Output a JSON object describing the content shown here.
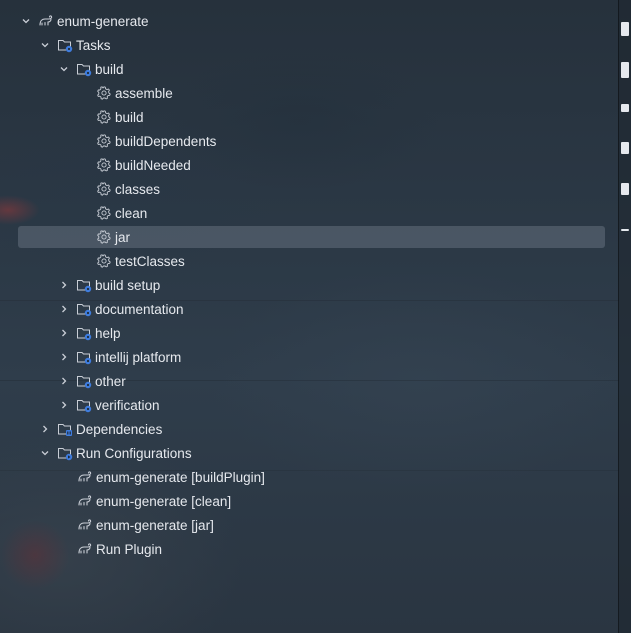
{
  "tree": {
    "root": {
      "label": "enum-generate",
      "icon": "gradle-elephant-icon"
    },
    "tasks": {
      "label": "Tasks",
      "icon": "folder-gear-icon"
    },
    "build_group": {
      "label": "build",
      "icon": "folder-gear-icon"
    },
    "build_tasks": [
      "assemble",
      "build",
      "buildDependents",
      "buildNeeded",
      "classes",
      "clean",
      "jar",
      "testClasses"
    ],
    "task_groups": [
      "build setup",
      "documentation",
      "help",
      "intellij platform",
      "other",
      "verification"
    ],
    "dependencies": {
      "label": "Dependencies",
      "icon": "folder-library-icon"
    },
    "run_configurations": {
      "label": "Run Configurations",
      "icon": "folder-run-icon",
      "items": [
        "enum-generate [buildPlugin]",
        "enum-generate [clean]",
        "enum-generate [jar]",
        "Run Plugin"
      ]
    },
    "selected_task": "jar"
  },
  "colors": {
    "text": "#e6e9ee",
    "selection": "#5a6573",
    "gear_badge": "#3f7ddf"
  }
}
